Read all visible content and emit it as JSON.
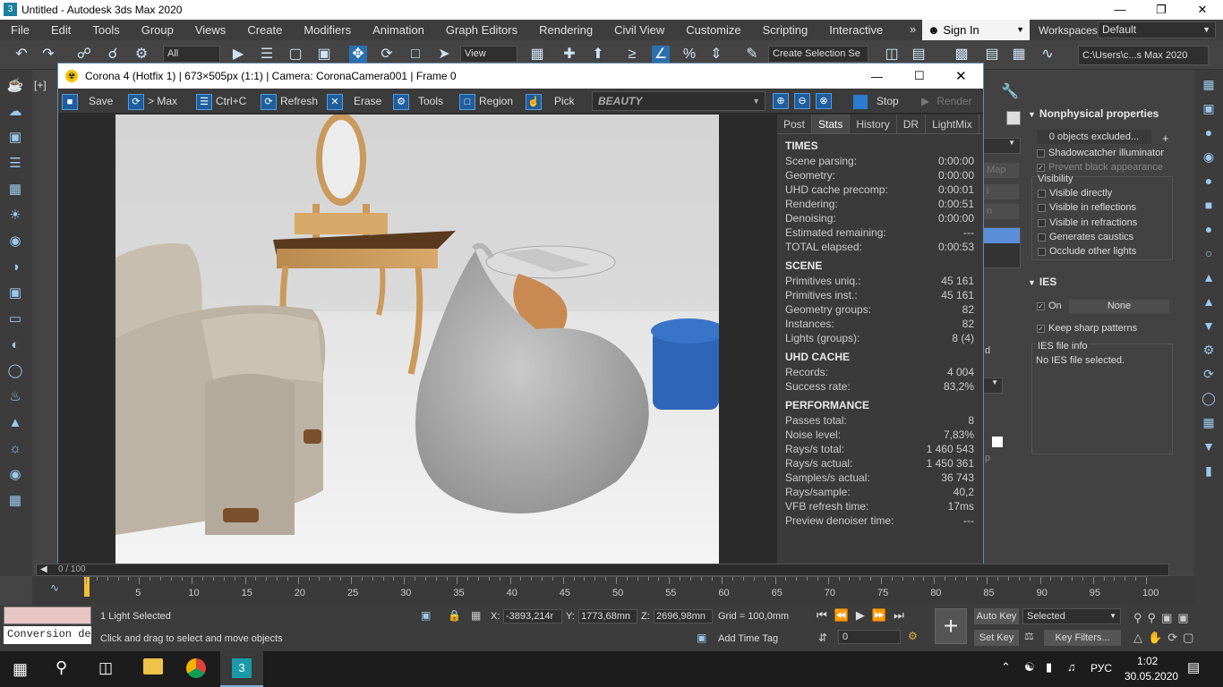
{
  "window": {
    "title": "Untitled - Autodesk 3ds Max 2020",
    "controls": [
      "—",
      "❐",
      "✕"
    ]
  },
  "menu": [
    "File",
    "Edit",
    "Tools",
    "Group",
    "Views",
    "Create",
    "Modifiers",
    "Animation",
    "Graph Editors",
    "Rendering",
    "Civil View",
    "Customize",
    "Scripting",
    "Interactive"
  ],
  "account": {
    "more": "»",
    "sign_in": "Sign In",
    "workspaces_label": "Workspaces:",
    "workspace": "Default"
  },
  "toolbar": {
    "filter": "All",
    "view": "View",
    "selection_set": "Create Selection Se",
    "path": "C:\\Users\\c...s Max 2020"
  },
  "viewport": {
    "label": "[+]"
  },
  "vfb": {
    "title": "Corona 4 (Hotfix 1) | 673×505px (1:1) | Camera: CoronaCamera001 | Frame 0",
    "buttons": {
      "save": "Save",
      "max": "> Max",
      "copy": "Ctrl+C",
      "refresh": "Refresh",
      "erase": "Erase",
      "tools": "Tools",
      "region": "Region",
      "pick": "Pick",
      "stop": "Stop",
      "render": "Render"
    },
    "pass": "BEAUTY",
    "tabs": [
      "Post",
      "Stats",
      "History",
      "DR",
      "LightMix"
    ],
    "sections": [
      {
        "title": "TIMES",
        "rows": [
          [
            "Scene parsing:",
            "0:00:00"
          ],
          [
            "Geometry:",
            "0:00:00"
          ],
          [
            "UHD cache precomp:",
            "0:00:01"
          ],
          [
            "Rendering:",
            "0:00:51"
          ],
          [
            "Denoising:",
            "0:00:00"
          ],
          [
            "Estimated remaining:",
            "---"
          ],
          [
            "TOTAL elapsed:",
            "0:00:53"
          ]
        ]
      },
      {
        "title": "SCENE",
        "rows": [
          [
            "Primitives uniq.:",
            "45 161"
          ],
          [
            "Primitives inst.:",
            "45 161"
          ],
          [
            "Geometry groups:",
            "82"
          ],
          [
            "Instances:",
            "82"
          ],
          [
            "Lights (groups):",
            "8 (4)"
          ]
        ]
      },
      {
        "title": "UHD CACHE",
        "rows": [
          [
            "Records:",
            "4 004"
          ],
          [
            "Success rate:",
            "83,2%"
          ]
        ]
      },
      {
        "title": "PERFORMANCE",
        "rows": [
          [
            "Passes total:",
            "8"
          ],
          [
            "Noise level:",
            "7,83%"
          ],
          [
            "Rays/s total:",
            "1 460 543"
          ],
          [
            "Rays/s actual:",
            "1 450 361"
          ],
          [
            "Samples/s actual:",
            "36 743"
          ],
          [
            "Rays/sample:",
            "40,2"
          ],
          [
            "VFB refresh time:",
            "17ms"
          ],
          [
            "Preview denoiser time:",
            "---"
          ]
        ]
      }
    ]
  },
  "command_panel": {
    "partial_labels": [
      "Map",
      "l",
      "n",
      "d",
      "p"
    ],
    "nonphysical": {
      "title": "Nonphysical properties",
      "excluded": "0 objects excluded...",
      "shadowcatcher": "Shadowcatcher illuminator",
      "prevent_black": "Prevent black appearance",
      "visibility": "Visibility",
      "items": [
        "Visible directly",
        "Visible in reflections",
        "Visible in refractions",
        "Generates caustics",
        "Occlude other lights"
      ]
    },
    "ies": {
      "title": "IES",
      "on": "On",
      "none": "None",
      "keep_sharp": "Keep sharp patterns",
      "file_info": "IES file info",
      "no_file": "No IES file selected."
    }
  },
  "timeline": {
    "frame": "0 / 100",
    "ticks": [
      "5",
      "10",
      "15",
      "20",
      "25",
      "30",
      "35",
      "40",
      "45",
      "50",
      "55",
      "60",
      "65",
      "70",
      "75",
      "80",
      "85",
      "90",
      "95",
      "100"
    ]
  },
  "status": {
    "conversion": "Conversion de",
    "selected": "1 Light Selected",
    "hint": "Click and drag to select and move objects",
    "x_label": "X:",
    "x": "-3893,214r",
    "y_label": "Y:",
    "y": "1773,68mn",
    "z_label": "Z:",
    "z": "2696,98mn",
    "grid": "Grid = 100,0mm",
    "add_time_tag": "Add Time Tag",
    "auto_key": "Auto Key",
    "set_key": "Set Key",
    "selected_dropdown": "Selected",
    "key_filters": "Key Filters...",
    "frame_value": "0"
  },
  "taskbar": {
    "lang": "РУС",
    "time": "1:02",
    "date": "30.05.2020"
  }
}
